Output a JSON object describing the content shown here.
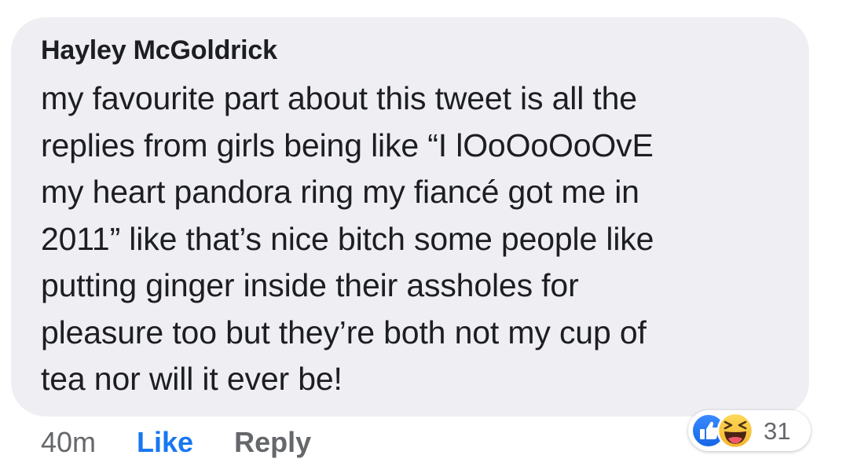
{
  "comment": {
    "author": "Hayley McGoldrick",
    "lines": [
      "my favourite part about this tweet is all the",
      "replies from girls being like “I lOoOoOoOvE",
      "my heart pandora ring my fiancé got me in",
      "2011” like that’s nice bitch some people like",
      "putting ginger inside their assholes for",
      "pleasure too but they’re both not my cup of",
      "tea nor will it ever be!"
    ]
  },
  "actions": {
    "timestamp": "40m",
    "like_label": "Like",
    "reply_label": "Reply"
  },
  "reactions": {
    "icons": [
      "like-reaction-icon",
      "haha-reaction-icon"
    ],
    "count": "31"
  },
  "colors": {
    "bubble_background": "#efeff3",
    "text": "#1c1e21",
    "secondary_text": "#65676b",
    "like_blue": "#1877f2",
    "haha_yellow": "#f7c436"
  }
}
